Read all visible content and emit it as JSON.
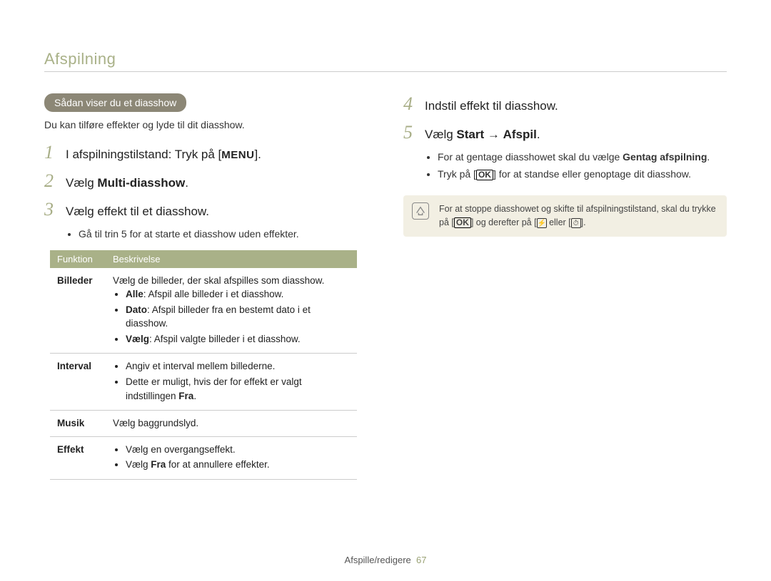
{
  "header": {
    "title": "Afspilning"
  },
  "left": {
    "pill": "Sådan viser du et diasshow",
    "intro": "Du kan tilføre effekter og lyde til dit diasshow.",
    "step1_prefix": "I afspilningstilstand: Tryk på [",
    "step1_menu": "MENU",
    "step1_suffix": "].",
    "step2_prefix": "Vælg ",
    "step2_bold": "Multi-diasshow",
    "step2_suffix": ".",
    "step3": "Vælg effekt til et diasshow.",
    "step3_bullet": "Gå til trin 5 for at starte et diasshow uden effekter.",
    "table": {
      "head_fn": "Funktion",
      "head_desc": "Beskrivelse",
      "rows": {
        "billeder": {
          "label": "Billeder",
          "line1": "Vælg de billeder, der skal afspilles som diasshow.",
          "alle_b": "Alle",
          "alle_t": ": Afspil alle billeder i et diasshow.",
          "dato_b": "Dato",
          "dato_t": ": Afspil billeder fra en bestemt dato i et diasshow.",
          "vaelg_b": "Vælg",
          "vaelg_t": ": Afspil valgte billeder i et diasshow."
        },
        "interval": {
          "label": "Interval",
          "b1": "Angiv et interval mellem billederne.",
          "b2_pre": "Dette er muligt, hvis der for effekt er valgt indstillingen ",
          "b2_bold": "Fra",
          "b2_suf": "."
        },
        "musik": {
          "label": "Musik",
          "text": "Vælg baggrundslyd."
        },
        "effekt": {
          "label": "Effekt",
          "b1": "Vælg en overgangseffekt.",
          "b2_pre": "Vælg ",
          "b2_bold": "Fra",
          "b2_suf": " for at annullere effekter."
        }
      }
    }
  },
  "right": {
    "step4": "Indstil effekt til diasshow.",
    "step5_pre": "Vælg ",
    "step5_bold": "Start",
    "step5_arrow": " → ",
    "step5_bold2": "Afspil",
    "step5_suf": ".",
    "b1_pre": "For at gentage diasshowet skal du vælge ",
    "b1_bold": "Gentag afspilning",
    "b1_suf": ".",
    "b2_pre": "Tryk på [",
    "b2_ok": "OK",
    "b2_suf": "] for at standse eller genoptage dit diasshow.",
    "note_pre": "For at stoppe diasshowet og skifte til afspilningstilstand, skal du trykke på [",
    "note_ok": "OK",
    "note_mid": "] og derefter på [",
    "note_end": "]."
  },
  "footer": {
    "section": "Afspille/redigere",
    "page": "67"
  }
}
